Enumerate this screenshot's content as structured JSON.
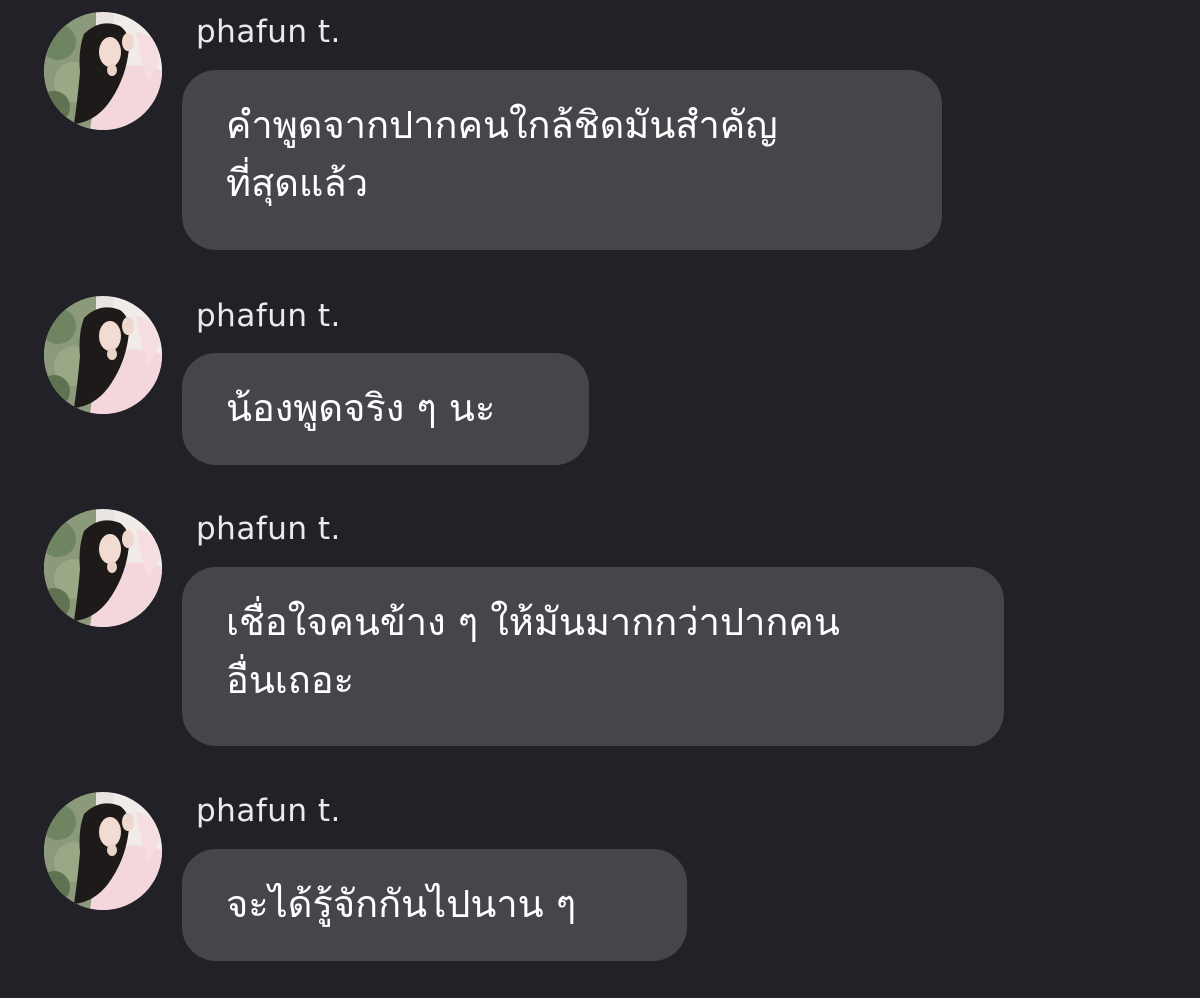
{
  "messages": [
    {
      "sender": "phafun t.",
      "avatar_icon": "profile-photo-icon",
      "lines": [
        "คำพูดจากปากคนใกล้ชิดมันสำคัญ",
        "ที่สุดแล้ว"
      ]
    },
    {
      "sender": "phafun t.",
      "avatar_icon": "profile-photo-icon",
      "lines": [
        "น้องพูดจริง ๆ นะ"
      ]
    },
    {
      "sender": "phafun t.",
      "avatar_icon": "profile-photo-icon",
      "lines": [
        "เชื่อใจคนข้าง ๆ ให้มันมากกว่าปากคน",
        "อื่นเถอะ"
      ]
    },
    {
      "sender": "phafun t.",
      "avatar_icon": "profile-photo-icon",
      "lines": [
        "จะได้รู้จักกันไปนาน ๆ"
      ]
    }
  ],
  "colors": {
    "background": "#212127",
    "bubble": "#45454c",
    "sender_text": "#e9e9ee",
    "message_text": "#ffffff"
  }
}
